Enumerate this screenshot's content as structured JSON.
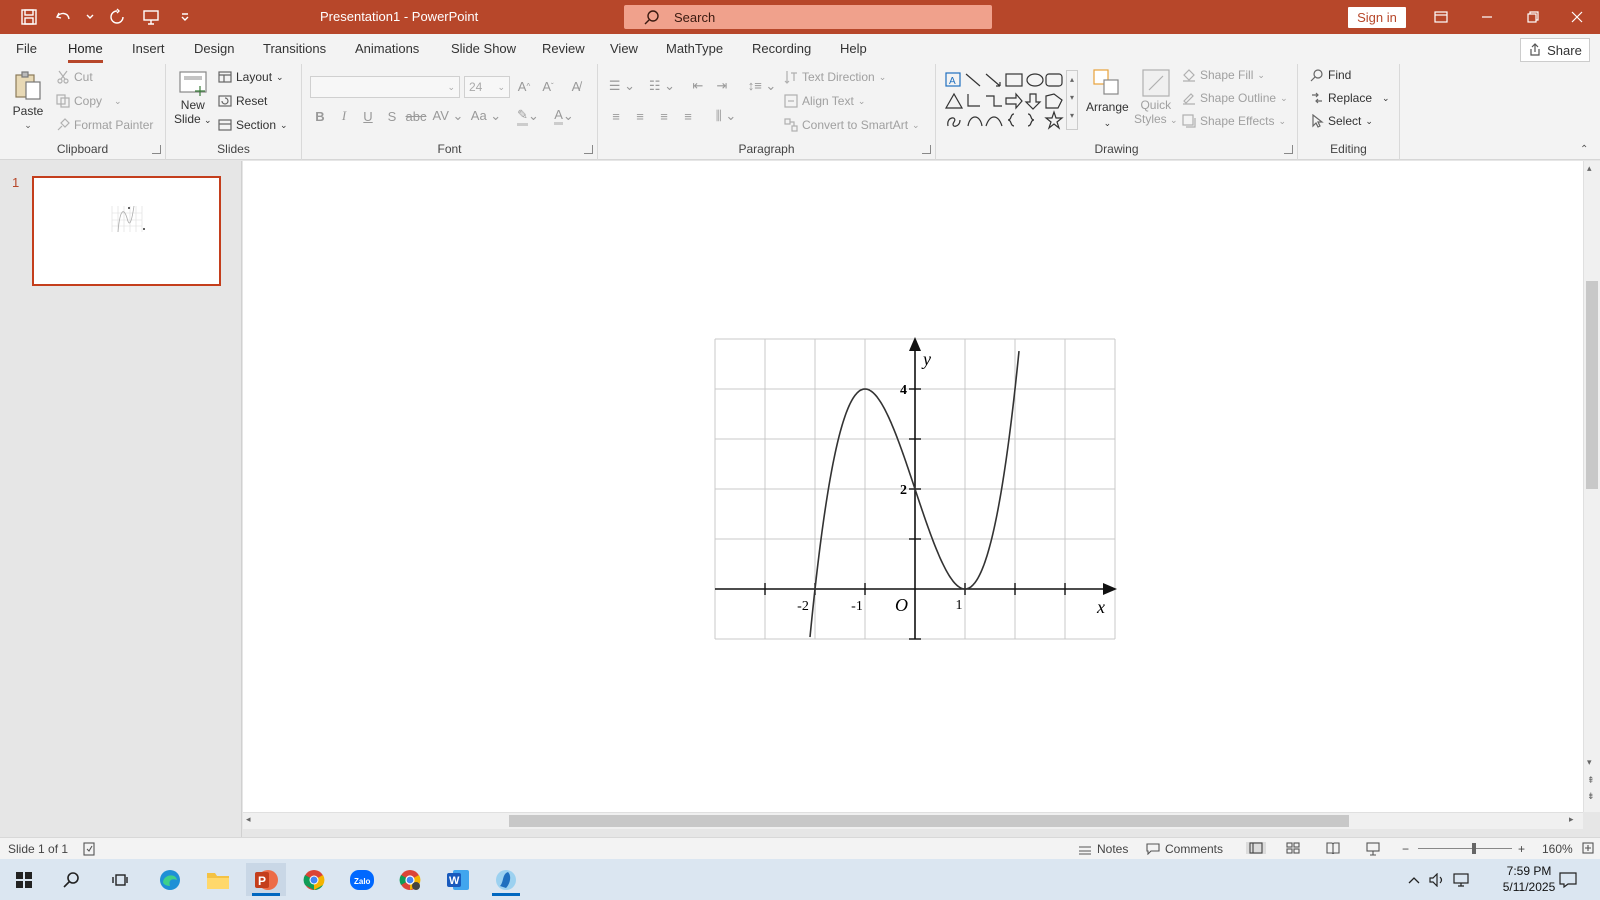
{
  "app": {
    "title": "Presentation1  -  PowerPoint",
    "search_placeholder": "Search",
    "sign_in": "Sign in",
    "share": "Share",
    "accent": "#b7472a"
  },
  "tabs": [
    "File",
    "Home",
    "Insert",
    "Design",
    "Transitions",
    "Animations",
    "Slide Show",
    "Review",
    "View",
    "MathType",
    "Recording",
    "Help"
  ],
  "active_tab": "Home",
  "ribbon": {
    "clipboard": {
      "label": "Clipboard",
      "paste": "Paste",
      "cut": "Cut",
      "copy": "Copy",
      "format_painter": "Format Painter"
    },
    "slides": {
      "label": "Slides",
      "new_slide_1": "New",
      "new_slide_2": "Slide",
      "layout": "Layout",
      "reset": "Reset",
      "section": "Section"
    },
    "font": {
      "label": "Font",
      "font_name": "",
      "font_size": "24"
    },
    "paragraph": {
      "label": "Paragraph",
      "text_direction": "Text Direction",
      "align_text": "Align Text",
      "convert_smartart": "Convert to SmartArt"
    },
    "drawing": {
      "label": "Drawing",
      "arrange": "Arrange",
      "quick_styles_1": "Quick",
      "quick_styles_2": "Styles",
      "shape_fill": "Shape Fill",
      "shape_outline": "Shape Outline",
      "shape_effects": "Shape Effects"
    },
    "editing": {
      "label": "Editing",
      "find": "Find",
      "replace": "Replace",
      "select": "Select"
    }
  },
  "thumbnail": {
    "number": "1"
  },
  "graph": {
    "x_label": "x",
    "y_label": "y",
    "origin_label": "O",
    "x_ticks": [
      "-2",
      "-1",
      "1"
    ],
    "y_ticks": [
      "4",
      "2"
    ],
    "grid_color": "#c8c8c8",
    "curve_color": "#333333"
  },
  "status": {
    "slide_info": "Slide 1 of 1",
    "notes": "Notes",
    "comments": "Comments",
    "zoom": "160%"
  },
  "taskbar": {
    "time": "7:59 PM",
    "date": "5/11/2025"
  }
}
